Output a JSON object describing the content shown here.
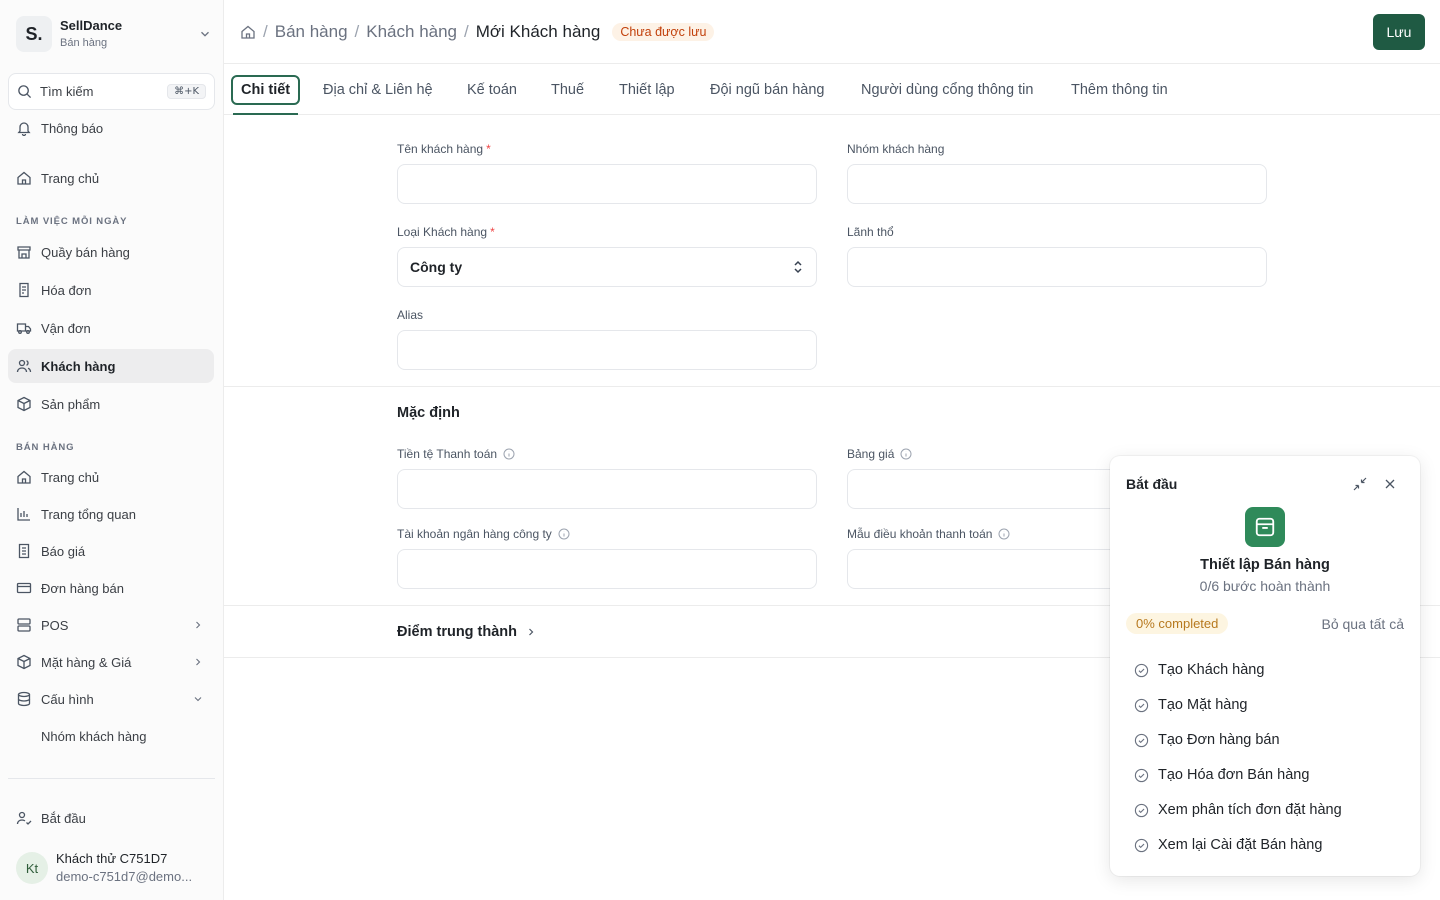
{
  "sidebar": {
    "brand": {
      "logo_letter": "S.",
      "name": "SellDance",
      "subtitle": "Bán hàng"
    },
    "search": {
      "label": "Tìm kiếm",
      "shortcut": "⌘+K"
    },
    "notifications": "Thông báo",
    "home": "Trang chủ",
    "section_daily": "LÀM VIỆC MỖI NGÀY",
    "daily_items": [
      "Quầy bán hàng",
      "Hóa đơn",
      "Vận đơn",
      "Khách hàng",
      "Sản phẩm"
    ],
    "section_sales": "BÁN HÀNG",
    "sales_items": [
      "Trang chủ",
      "Trang tổng quan",
      "Báo giá",
      "Đơn hàng bán",
      "POS",
      "Mặt hàng & Giá",
      "Cấu hình",
      "Nhóm khách hàng"
    ],
    "get_started": "Bắt đầu",
    "user": {
      "initials": "Kt",
      "name": "Khách thử C751D7",
      "email": "demo-c751d7@demo..."
    }
  },
  "header": {
    "breadcrumbs": [
      "Bán hàng",
      "Khách hàng"
    ],
    "current": "Mới Khách hàng",
    "status_badge": "Chưa được lưu",
    "save_label": "Lưu"
  },
  "tabs": [
    "Chi tiết",
    "Địa chỉ & Liên hệ",
    "Kế toán",
    "Thuế",
    "Thiết lập",
    "Đội ngũ bán hàng",
    "Người dùng cổng thông tin",
    "Thêm thông tin"
  ],
  "form": {
    "customer_name_label": "Tên khách hàng",
    "customer_group_label": "Nhóm khách hàng",
    "customer_type_label": "Loại Khách hàng",
    "customer_type_value": "Công ty",
    "territory_label": "Lãnh thổ",
    "alias_label": "Alias",
    "defaults_title": "Mặc định",
    "billing_currency_label": "Tiền tệ Thanh toán",
    "price_list_label": "Bảng giá",
    "bank_account_label": "Tài khoản ngân hàng công ty",
    "payment_terms_label": "Mẫu điều khoản thanh toán",
    "loyalty_title": "Điểm trung thành"
  },
  "onboarding": {
    "title": "Bắt đầu",
    "heading": "Thiết lập Bán hàng",
    "subtitle": "0/6 bước hoàn thành",
    "progress": "0% completed",
    "skip_all": "Bỏ qua tất cả",
    "steps": [
      "Tạo Khách hàng",
      "Tạo Mặt hàng",
      "Tạo Đơn hàng bán",
      "Tạo Hóa đơn Bán hàng",
      "Xem phân tích đơn đặt hàng",
      "Xem lại Cài đặt Bán hàng"
    ]
  },
  "colors": {
    "primary": "#1f5a43",
    "accent": "#2a6a52",
    "warning_text": "#c2410c"
  }
}
